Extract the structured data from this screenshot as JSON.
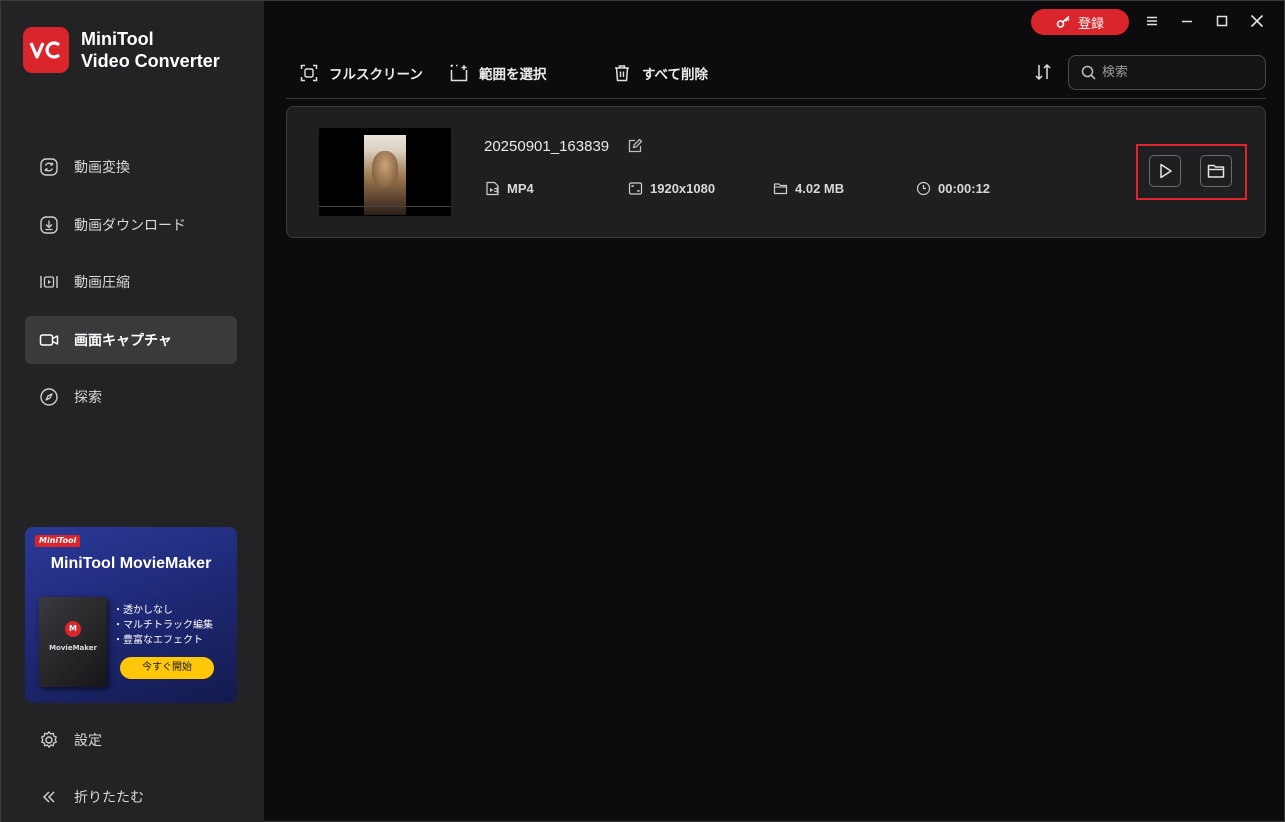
{
  "app": {
    "brand_line1": "MiniTool",
    "brand_line2": "Video Converter",
    "accent_color": "#d9252b"
  },
  "sidebar": {
    "items": [
      {
        "label": "動画変換",
        "icon": "convert-icon",
        "active": false
      },
      {
        "label": "動画ダウンロード",
        "icon": "download-icon",
        "active": false
      },
      {
        "label": "動画圧縮",
        "icon": "compress-icon",
        "active": false
      },
      {
        "label": "画面キャプチャ",
        "icon": "video-camera-icon",
        "active": true
      },
      {
        "label": "探索",
        "icon": "compass-icon",
        "active": false
      }
    ],
    "settings_label": "設定",
    "collapse_label": "折りたたむ"
  },
  "promo": {
    "badge": "MiniTool",
    "title": "MiniTool MovieMaker",
    "box_label": "MovieMaker",
    "features": [
      "・透かしなし",
      "・マルチトラック編集",
      "・豊富なエフェクト"
    ],
    "cta": "今すぐ開始"
  },
  "titlebar": {
    "register_label": "登録"
  },
  "toolbar": {
    "fullscreen_label": "フルスクリーン",
    "select_region_label": "範囲を選択",
    "delete_all_label": "すべて削除",
    "search_placeholder": "検索"
  },
  "recordings": [
    {
      "name": "20250901_163839",
      "format": "MP4",
      "resolution": "1920x1080",
      "size": "4.02 MB",
      "duration": "00:00:12"
    }
  ]
}
